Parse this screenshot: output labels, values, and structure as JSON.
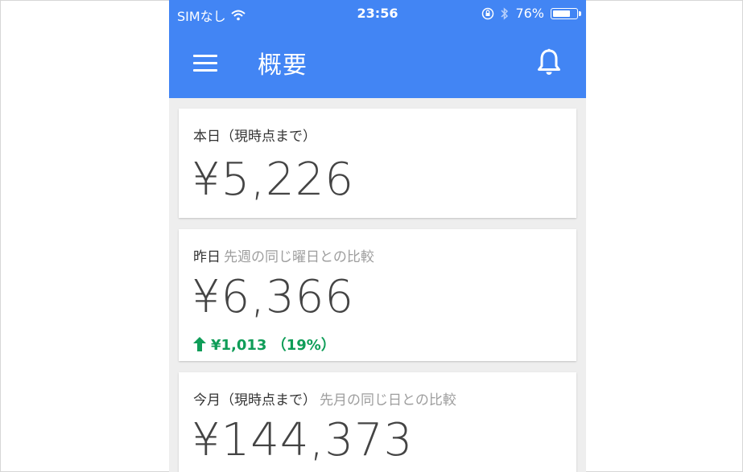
{
  "statusbar": {
    "carrier": "SIMなし",
    "time": "23:56",
    "battery": "76%",
    "battery_level": 0.76
  },
  "appbar": {
    "title": "概要"
  },
  "cards": [
    {
      "label": "本日（現時点まで）",
      "sublabel": "",
      "value": "¥5,226"
    },
    {
      "label": "昨日",
      "sublabel": "先週の同じ曜日との比較",
      "value": "¥6,366",
      "delta": "¥1,013 （19%）"
    },
    {
      "label": "今月（現時点まで）",
      "sublabel": "先月の同じ日との比較",
      "value": "¥144,373"
    }
  ],
  "colors": {
    "accent": "#4285f4",
    "positive": "#0f9d58"
  }
}
